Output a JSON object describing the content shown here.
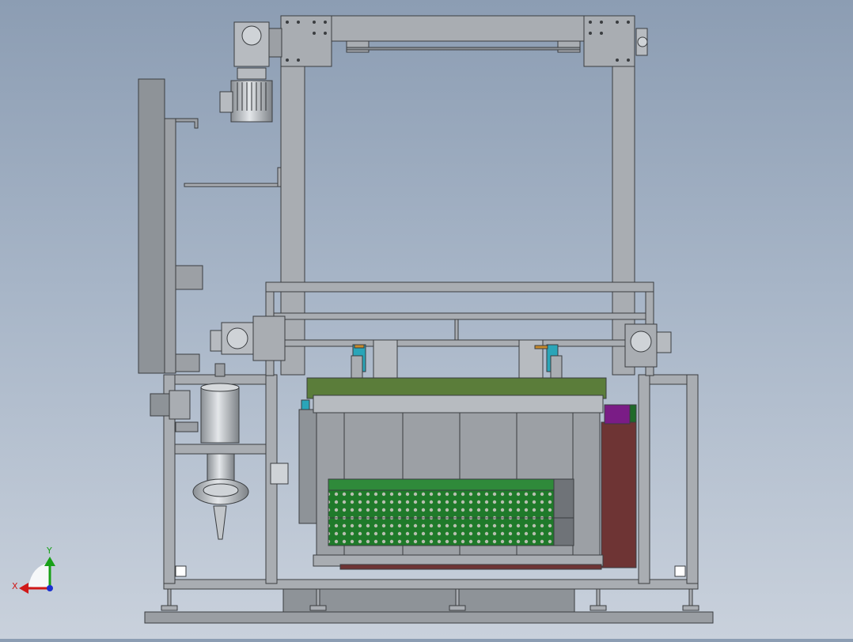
{
  "viewport": {
    "background_top": "#8c9db3",
    "background_bottom": "#c9d1dc"
  },
  "triad": {
    "x_label": "X",
    "y_label": "Y",
    "x_color": "#d01818",
    "y_color": "#18a018",
    "z_color": "#1a2fd0"
  },
  "palette": {
    "frame_fill": "#a9adb2",
    "frame_stroke": "#3a3d40",
    "panel_fill": "#8e9398",
    "motor_fill": "#b7bbc0",
    "tank_wall": "#2f8a3a",
    "basket_fill": "#1f7a2a",
    "rack_green": "#5b7d3a",
    "purple_block": "#7a1c86",
    "maroon_panel": "#6e3434",
    "teal_accent": "#2aa5b8",
    "orange_accent": "#c88a2a"
  }
}
